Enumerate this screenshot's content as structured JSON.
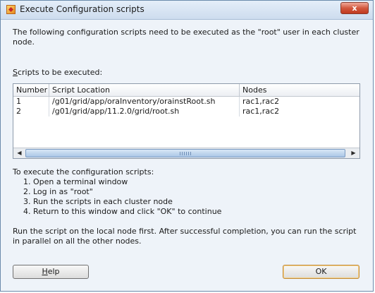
{
  "window": {
    "title": "Execute Configuration scripts",
    "close_glyph": "x",
    "icon": "app-icon"
  },
  "intro_text": "The following configuration scripts need to be executed as the \"root\" user in each cluster node.",
  "scripts_label": "Scripts to be executed:",
  "table": {
    "headers": [
      "Number",
      "Script Location",
      "Nodes"
    ],
    "rows": [
      [
        "1",
        "/g01/grid/app/oraInventory/orainstRoot.sh",
        "rac1,rac2"
      ],
      [
        "2",
        "/g01/grid/app/11.2.0/grid/root.sh",
        "rac1,rac2"
      ]
    ]
  },
  "scrollbar": {
    "left_icon": "scroll-left-icon",
    "right_icon": "scroll-right-icon"
  },
  "instructions": {
    "title": "To execute the configuration scripts:",
    "steps": [
      "1. Open a terminal window",
      "2. Log in as \"root\"",
      "3. Run the scripts in each cluster node",
      "4. Return to this window and click \"OK\" to continue"
    ]
  },
  "note": "Run the script on the local node first. After successful completion, you can run the script in parallel on all the other nodes.",
  "buttons": {
    "help": "Help",
    "ok": "OK"
  },
  "colors": {
    "accent": "#7b9bc3",
    "close": "#c0391f"
  }
}
